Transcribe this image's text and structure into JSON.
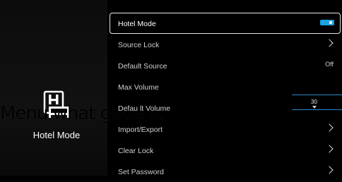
{
  "left_panel": {
    "icon": "hotel-building-icon",
    "title": "Hotel Mode",
    "overlay_text": "Menu what gede to"
  },
  "menu": {
    "items": [
      {
        "label": "Hotel Mode",
        "control": "toggle",
        "state": "on"
      },
      {
        "label": "Source Lock",
        "control": "chevron"
      },
      {
        "label": "Default Source",
        "control": "value",
        "value": "Off"
      },
      {
        "label": "Max Volume",
        "control": "slider"
      },
      {
        "label": "Defau lt Volume",
        "control": "slider",
        "value": "30"
      },
      {
        "label": "Import/Export",
        "control": "chevron"
      },
      {
        "label": "Clear Lock",
        "control": "chevron"
      },
      {
        "label": "Set Password",
        "control": "chevron"
      }
    ]
  },
  "colors": {
    "accent": "#1aa3e0",
    "slider": "#2b87c8",
    "background": "#000000"
  }
}
